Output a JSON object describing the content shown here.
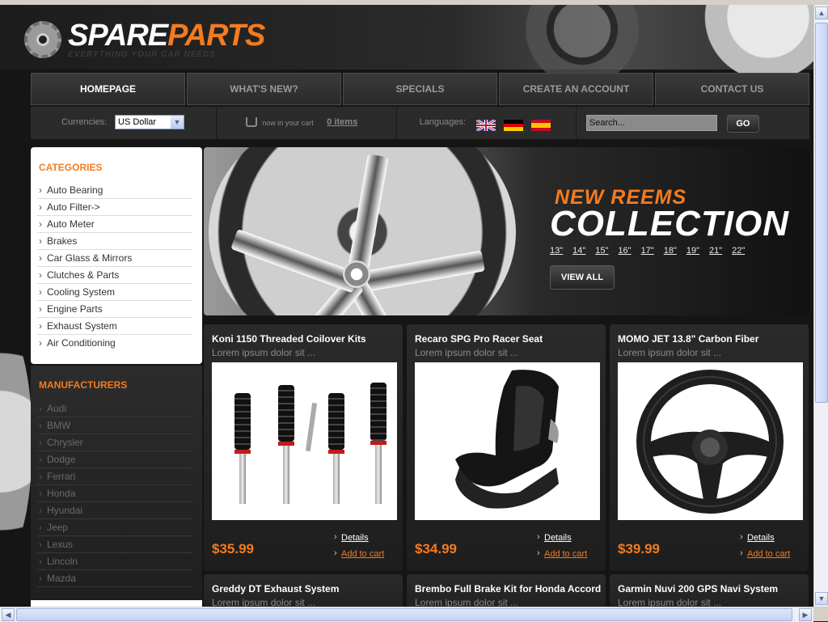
{
  "brand": {
    "name_part1": "SPARE",
    "name_part2": "PARTS",
    "tagline": "EVERYTHING YOUR CAR NEEDS"
  },
  "nav": [
    {
      "label": "HOMEPAGE",
      "active": true
    },
    {
      "label": "WHAT'S NEW?",
      "active": false
    },
    {
      "label": "SPECIALS",
      "active": false
    },
    {
      "label": "CREATE AN ACCOUNT",
      "active": false
    },
    {
      "label": "CONTACT US",
      "active": false
    }
  ],
  "infobar": {
    "currencies_label": "Currencies:",
    "currency_value": "US Dollar",
    "cart_text": "now in your cart",
    "cart_items": "0 items",
    "languages_label": "Languages:",
    "search_placeholder": "Search...",
    "go_label": "GO"
  },
  "categories": {
    "title": "CATEGORIES",
    "items": [
      "Auto Bearing",
      "Auto Filter->",
      "Auto Meter",
      "Brakes",
      "Car Glass & Mirrors",
      "Clutches & Parts",
      "Cooling System",
      "Engine Parts",
      "Exhaust System",
      "Air Conditioning"
    ]
  },
  "manufacturers": {
    "title": "MANUFACTURERS",
    "items": [
      "Audi",
      "BMW",
      "Chrysler",
      "Dodge",
      "Ferrari",
      "Honda",
      "Hyundai",
      "Jeep",
      "Lexus",
      "Lincoln",
      "Mazda"
    ]
  },
  "banner": {
    "line1": "NEW REEMS",
    "line2": "COLLECTION",
    "sizes": [
      "13\"",
      "14\"",
      "15\"",
      "16\"",
      "17\"",
      "18\"",
      "19\"",
      "21\"",
      "22\""
    ],
    "button": "VIEW ALL"
  },
  "products": [
    {
      "name": "Koni 1150 Threaded Coilover Kits",
      "desc": "Lorem ipsum dolor sit ...",
      "price": "$35.99",
      "details": "Details",
      "cart": "Add to cart"
    },
    {
      "name": "Recaro SPG Pro Racer Seat",
      "desc": "Lorem ipsum dolor sit ...",
      "price": "$34.99",
      "details": "Details",
      "cart": "Add to cart"
    },
    {
      "name": "MOMO JET 13.8\" Carbon Fiber",
      "desc": "Lorem ipsum dolor sit ...",
      "price": "$39.99",
      "details": "Details",
      "cart": "Add to cart"
    },
    {
      "name": "Greddy DT Exhaust System",
      "desc": "Lorem ipsum dolor sit ..."
    },
    {
      "name": "Brembo Full Brake Kit for Honda Accord",
      "desc": "Lorem ipsum dolor sit ..."
    },
    {
      "name": "Garmin Nuvi 200 GPS Navi System",
      "desc": "Lorem ipsum dolor sit ..."
    }
  ],
  "icons": {
    "logo": "gear-icon",
    "cart": "shopping-cart-icon",
    "flags": [
      "flag-uk-icon",
      "flag-germany-icon",
      "flag-spain-icon"
    ],
    "bullet": "chevron-right-icon"
  },
  "colors": {
    "accent": "#f47b20",
    "background": "#151515",
    "panel": "#2a2a2a"
  }
}
